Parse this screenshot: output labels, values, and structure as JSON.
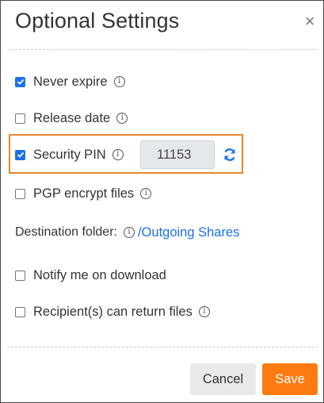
{
  "dialog": {
    "title": "Optional Settings",
    "close_glyph": "×"
  },
  "options": {
    "never_expire": {
      "label": "Never expire",
      "checked": true
    },
    "release_date": {
      "label": "Release date",
      "checked": false
    },
    "security_pin": {
      "label": "Security PIN",
      "checked": true,
      "value": "11153"
    },
    "pgp_encrypt": {
      "label": "PGP encrypt files",
      "checked": false
    },
    "notify_download": {
      "label": "Notify me on download",
      "checked": false
    },
    "recipient_return": {
      "label": "Recipient(s) can return files",
      "checked": false
    }
  },
  "destination": {
    "label": "Destination folder:",
    "folder": "/Outgoing Shares"
  },
  "buttons": {
    "cancel": "Cancel",
    "save": "Save"
  },
  "colors": {
    "accent": "#1a73e8",
    "highlight_border": "#e8872c",
    "save_button": "#ff7a10"
  },
  "icons": [
    "info-icon",
    "refresh-icon",
    "close-icon",
    "checkmark-icon"
  ]
}
